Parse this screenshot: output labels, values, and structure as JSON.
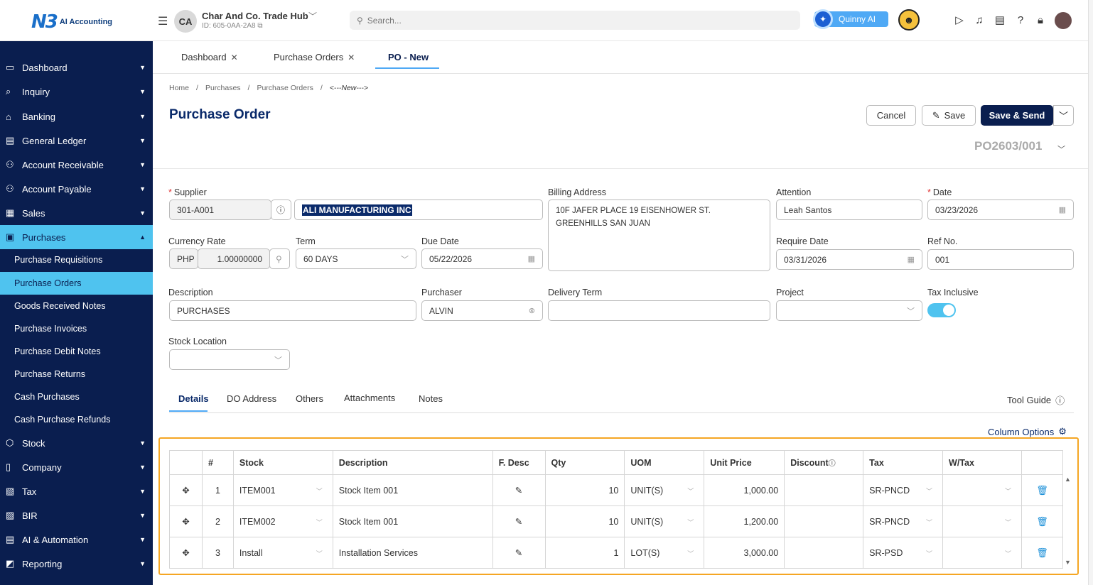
{
  "app": {
    "logo_mark": "N3",
    "logo_text": "AI Accounting"
  },
  "company": {
    "initials": "CA",
    "name": "Char And Co. Trade Hub",
    "id": "ID: 605-0AA-2A8"
  },
  "search": {
    "placeholder": "Search..."
  },
  "quinny": {
    "label": "Quinny AI"
  },
  "sidebar": {
    "items": [
      {
        "label": "Dashboard",
        "icon": "monitor-icon"
      },
      {
        "label": "Inquiry",
        "icon": "inquiry-icon"
      },
      {
        "label": "Banking",
        "icon": "bank-icon"
      },
      {
        "label": "General Ledger",
        "icon": "ledger-icon"
      },
      {
        "label": "Account Receivable",
        "icon": "receivable-icon"
      },
      {
        "label": "Account Payable",
        "icon": "payable-icon"
      },
      {
        "label": "Sales",
        "icon": "sales-icon"
      },
      {
        "label": "Purchases",
        "icon": "cart-icon"
      },
      {
        "label": "Stock",
        "icon": "box-icon"
      },
      {
        "label": "Company",
        "icon": "company-icon"
      },
      {
        "label": "Tax",
        "icon": "tax-icon"
      },
      {
        "label": "BIR",
        "icon": "bir-icon"
      },
      {
        "label": "AI & Automation",
        "icon": "ai-icon"
      },
      {
        "label": "Reporting",
        "icon": "chart-icon"
      }
    ],
    "sub": [
      "Purchase Requisitions",
      "Purchase Orders",
      "Goods Received Notes",
      "Purchase Invoices",
      "Purchase Debit Notes",
      "Purchase Returns",
      "Cash Purchases",
      "Cash Purchase Refunds"
    ]
  },
  "tabs": [
    "Dashboard",
    "Purchase Orders",
    "PO - New"
  ],
  "breadcrumb": [
    "Home",
    "Purchases",
    "Purchase Orders",
    "<---New--->"
  ],
  "page": {
    "title": "Purchase Order",
    "doc_no": "PO2603/001",
    "buttons": {
      "cancel": "Cancel",
      "save": "Save",
      "save_send": "Save & Send"
    }
  },
  "form": {
    "supplier": {
      "label": "Supplier",
      "code": "301-A001",
      "name": "ALI MANUFACTURING INC"
    },
    "billing_address": {
      "label": "Billing Address",
      "line1": "10F JAFER PLACE 19 EISENHOWER ST.",
      "line2": "GREENHILLS SAN JUAN"
    },
    "attention": {
      "label": "Attention",
      "value": "Leah Santos"
    },
    "date": {
      "label": "Date",
      "value": "03/23/2026"
    },
    "currency_rate": {
      "label": "Currency Rate",
      "currency": "PHP",
      "rate": "1.00000000"
    },
    "term": {
      "label": "Term",
      "value": "60 DAYS"
    },
    "due_date": {
      "label": "Due Date",
      "value": "05/22/2026"
    },
    "require_date": {
      "label": "Require Date",
      "value": "03/31/2026"
    },
    "ref_no": {
      "label": "Ref No.",
      "value": "001"
    },
    "description": {
      "label": "Description",
      "value": "PURCHASES"
    },
    "purchaser": {
      "label": "Purchaser",
      "value": "ALVIN"
    },
    "delivery_term": {
      "label": "Delivery Term",
      "value": ""
    },
    "project": {
      "label": "Project",
      "value": ""
    },
    "tax_inclusive": {
      "label": "Tax Inclusive",
      "on": true
    },
    "stock_location": {
      "label": "Stock Location",
      "value": ""
    }
  },
  "detail_tabs": [
    "Details",
    "DO Address",
    "Others",
    "Attachments",
    "Notes"
  ],
  "tool_guide": "Tool Guide",
  "column_options": "Column Options",
  "grid": {
    "headers": [
      "",
      "#",
      "Stock",
      "Description",
      "F. Desc",
      "Qty",
      "UOM",
      "Unit Price",
      "Discount",
      "Tax",
      "W/Tax",
      ""
    ],
    "rows": [
      {
        "no": "1",
        "stock": "ITEM001",
        "description": "Stock Item 001",
        "qty": "10",
        "uom": "UNIT(S)",
        "unit_price": "1,000.00",
        "discount": "",
        "tax": "SR-PNCD",
        "wtax": ""
      },
      {
        "no": "2",
        "stock": "ITEM002",
        "description": "Stock Item 001",
        "qty": "10",
        "uom": "UNIT(S)",
        "unit_price": "1,200.00",
        "discount": "",
        "tax": "SR-PNCD",
        "wtax": ""
      },
      {
        "no": "3",
        "stock": "Install",
        "description": "Installation Services",
        "qty": "1",
        "uom": "LOT(S)",
        "unit_price": "3,000.00",
        "discount": "",
        "tax": "SR-PSD",
        "wtax": ""
      }
    ]
  },
  "colors": {
    "navy": "#0a1e4f",
    "accent": "#4fc3ef",
    "highlight_border": "#f5a623"
  }
}
